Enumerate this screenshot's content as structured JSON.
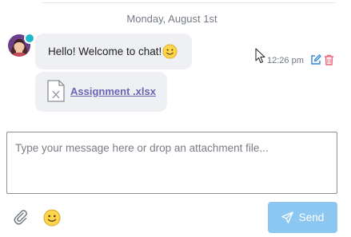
{
  "chat": {
    "date_separator": "Monday, August 1st",
    "messages": [
      {
        "type": "text",
        "text": "Hello! Welcome to chat!",
        "emoji_icon": "slightly-smiling-face-icon",
        "time": "12:26 pm",
        "actions": [
          "edit-icon",
          "delete-icon"
        ]
      },
      {
        "type": "file",
        "file_icon": "excel-file-icon",
        "file_name": "Assignment .xlsx"
      }
    ]
  },
  "composer": {
    "placeholder": "Type your message here or drop an attachment file...",
    "value": "",
    "attach_icon": "paperclip-icon",
    "emoji_icon": "smiley-icon",
    "send_label": "Send",
    "send_icon": "paper-plane-icon"
  },
  "colors": {
    "bubble_bg": "#eef0f3",
    "link": "#6c63b5",
    "send_button": "#8cc7f2",
    "edit_icon": "#2f86d8",
    "delete_icon": "#e8607a",
    "online_indicator": "#1fb8c9"
  }
}
